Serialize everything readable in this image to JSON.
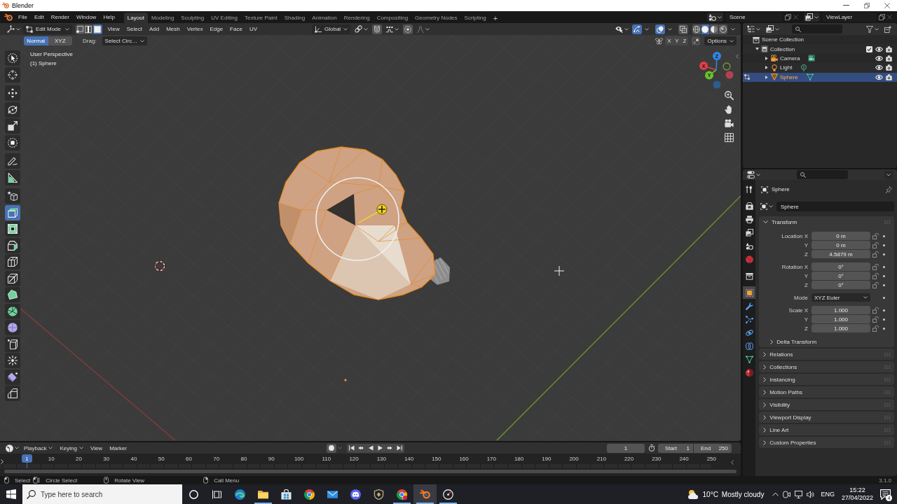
{
  "window": {
    "title": "Blender"
  },
  "menus": [
    "File",
    "Edit",
    "Render",
    "Window",
    "Help"
  ],
  "workspaces": [
    {
      "label": "Layout",
      "selected": true
    },
    {
      "label": "Modeling",
      "selected": false
    },
    {
      "label": "Sculpting",
      "selected": false
    },
    {
      "label": "UV Editing",
      "selected": false
    },
    {
      "label": "Texture Paint",
      "selected": false
    },
    {
      "label": "Shading",
      "selected": false
    },
    {
      "label": "Animation",
      "selected": false
    },
    {
      "label": "Rendering",
      "selected": false
    },
    {
      "label": "Compositing",
      "selected": false
    },
    {
      "label": "Geometry Nodes",
      "selected": false
    },
    {
      "label": "Scripting",
      "selected": false
    }
  ],
  "add_workspace": "+",
  "scene": "Scene",
  "view_layer": "ViewLayer",
  "viewport": {
    "mode": "Edit Mode",
    "select_modes": [
      {
        "kind": "vertex",
        "selected": false
      },
      {
        "kind": "edge",
        "selected": false
      },
      {
        "kind": "face",
        "selected": true
      }
    ],
    "menus": [
      "View",
      "Select",
      "Add",
      "Mesh",
      "Vertex",
      "Edge",
      "Face",
      "UV"
    ],
    "orientation": "Global",
    "snap": false,
    "proportional": false,
    "gizmos": true,
    "overlays": true,
    "xray": false,
    "shading": [
      {
        "kind": "wireframe",
        "selected": false
      },
      {
        "kind": "solid",
        "selected": true
      },
      {
        "kind": "material",
        "selected": false
      },
      {
        "kind": "rendered",
        "selected": false
      }
    ],
    "orient_modes": [
      {
        "label": "Normal",
        "selected": true
      },
      {
        "label": "XYZ",
        "selected": false
      }
    ],
    "drag_label": "Drag:",
    "drag_tool": "Select Circ…",
    "mirror_axes": [
      {
        "label": "X",
        "on": false
      },
      {
        "label": "Y",
        "on": false
      },
      {
        "label": "Z",
        "on": false
      }
    ],
    "auto_merge": false,
    "options": "Options",
    "info": [
      "User Perspective",
      "(1) Sphere"
    ],
    "tools": [
      [
        {
          "kind": "select_circle",
          "selected": false
        },
        {
          "kind": "cursor",
          "selected": false
        }
      ],
      [
        {
          "kind": "move",
          "selected": false
        },
        {
          "kind": "rotate",
          "selected": false
        },
        {
          "kind": "scale",
          "selected": false
        },
        {
          "kind": "transform",
          "selected": false
        }
      ],
      [
        {
          "kind": "annotate",
          "selected": false
        },
        {
          "kind": "measure",
          "selected": false
        }
      ],
      [
        {
          "kind": "add_cube",
          "selected": false
        },
        {
          "kind": "extrude_region",
          "selected": true
        },
        {
          "kind": "inset",
          "selected": false
        },
        {
          "kind": "bevel",
          "selected": false
        },
        {
          "kind": "loop_cut",
          "selected": false
        },
        {
          "kind": "knife",
          "selected": false
        },
        {
          "kind": "poly_build",
          "selected": false
        },
        {
          "kind": "spin",
          "selected": false
        },
        {
          "kind": "smooth",
          "selected": false
        },
        {
          "kind": "edge_slide",
          "selected": false
        },
        {
          "kind": "shrink_fatten",
          "selected": false
        },
        {
          "kind": "shear",
          "selected": false
        },
        {
          "kind": "rip",
          "selected": false
        }
      ]
    ],
    "gizmo_axes": [
      "X",
      "Y",
      "Z"
    ]
  },
  "outliner": {
    "tree": [
      {
        "label": "Scene Collection",
        "kind": "scene_collection",
        "selected": false,
        "children": [
          {
            "label": "Collection",
            "kind": "collection",
            "selected": false,
            "expanded": true,
            "checked": true,
            "visible": true,
            "renderable": true,
            "children": [
              {
                "label": "Camera",
                "kind": "camera",
                "selected": false,
                "expanded": false,
                "visible": true,
                "renderable": true
              },
              {
                "label": "Light",
                "kind": "light",
                "selected": false,
                "expanded": false,
                "visible": true,
                "renderable": true
              },
              {
                "label": "Sphere",
                "kind": "mesh",
                "selected": true,
                "editing": true,
                "expanded": false,
                "visible": true,
                "renderable": true
              }
            ]
          }
        ]
      }
    ]
  },
  "properties": {
    "tabs": [
      [
        {
          "kind": "tool",
          "selected": false
        }
      ],
      [
        {
          "kind": "render",
          "selected": false
        },
        {
          "kind": "output",
          "selected": false
        },
        {
          "kind": "view_layer",
          "selected": false
        },
        {
          "kind": "scene",
          "selected": false
        },
        {
          "kind": "world",
          "selected": false
        }
      ],
      [
        {
          "kind": "collection",
          "selected": false
        }
      ],
      [
        {
          "kind": "object",
          "selected": true
        },
        {
          "kind": "modifiers",
          "selected": false
        },
        {
          "kind": "particles",
          "selected": false
        },
        {
          "kind": "physics",
          "selected": false
        },
        {
          "kind": "constraints",
          "selected": false
        },
        {
          "kind": "data",
          "selected": false
        },
        {
          "kind": "material",
          "selected": false
        }
      ]
    ],
    "context": "Sphere",
    "object_name": "Sphere",
    "transform": {
      "title": "Transform",
      "expanded": true,
      "groups": [
        [
          {
            "kind": "number",
            "label": "Location X",
            "value": "0 m",
            "locked": false
          },
          {
            "kind": "number",
            "label": "Y",
            "value": "0 m",
            "locked": false
          },
          {
            "kind": "number",
            "label": "Z",
            "value": "4.5879 m",
            "locked": false
          }
        ],
        [
          {
            "kind": "number",
            "label": "Rotation X",
            "value": "0°",
            "locked": false
          },
          {
            "kind": "number",
            "label": "Y",
            "value": "0°",
            "locked": false
          },
          {
            "kind": "number",
            "label": "Z",
            "value": "0°",
            "locked": false
          }
        ],
        [
          {
            "kind": "dropdown",
            "label": "Mode",
            "value": "XYZ Euler"
          }
        ],
        [
          {
            "kind": "number",
            "label": "Scale X",
            "value": "1.000",
            "locked": false
          },
          {
            "kind": "number",
            "label": "Y",
            "value": "1.000",
            "locked": false
          },
          {
            "kind": "number",
            "label": "Z",
            "value": "1.000",
            "locked": false
          }
        ]
      ],
      "subpanels": [
        {
          "title": "Delta Transform",
          "expanded": false
        }
      ]
    },
    "panels": [
      {
        "title": "Relations",
        "expanded": false
      },
      {
        "title": "Collections",
        "expanded": false
      },
      {
        "title": "Instancing",
        "expanded": false
      },
      {
        "title": "Motion Paths",
        "expanded": false
      },
      {
        "title": "Visibility",
        "expanded": false
      },
      {
        "title": "Viewport Display",
        "expanded": false
      },
      {
        "title": "Line Art",
        "expanded": false
      },
      {
        "title": "Custom Properties",
        "expanded": false
      }
    ]
  },
  "timeline": {
    "menus": [
      {
        "label": "Playback",
        "kind": "dropdown"
      },
      {
        "label": "Keying",
        "kind": "dropdown"
      },
      {
        "label": "View",
        "kind": "menu"
      },
      {
        "label": "Marker",
        "kind": "menu"
      }
    ],
    "auto_key": false,
    "current_frame": "1",
    "start_label": "Start",
    "start": "1",
    "end_label": "End",
    "end": "250",
    "playhead": "1",
    "ruler": [
      "10",
      "20",
      "30",
      "40",
      "50",
      "60",
      "70",
      "80",
      "90",
      "100",
      "110",
      "120",
      "130",
      "140",
      "150",
      "160",
      "170",
      "180",
      "190",
      "200",
      "210",
      "220",
      "230",
      "240",
      "250"
    ]
  },
  "status_bar": {
    "hints": [
      {
        "kind": "left_click",
        "label": "Select"
      },
      {
        "kind": "left_drag",
        "label": "Circle Select"
      },
      {
        "kind": "middle_drag",
        "label": "Rotate View"
      },
      {
        "kind": "right_click",
        "label": "Call Menu"
      }
    ],
    "version": "3.1.0"
  },
  "taskbar": {
    "search": {
      "placeholder": "Type here to search"
    },
    "apps": [
      {
        "kind": "edge",
        "running": false,
        "active": false
      },
      {
        "kind": "explorer",
        "running": true,
        "active": false
      },
      {
        "kind": "store",
        "running": false,
        "active": false
      },
      {
        "kind": "chrome",
        "running": false,
        "active": false
      },
      {
        "kind": "mail",
        "running": false,
        "active": false
      },
      {
        "kind": "discord",
        "running": false,
        "active": false
      },
      {
        "kind": "league",
        "running": false,
        "active": false
      },
      {
        "kind": "chrome_profile",
        "running": true,
        "active": false
      },
      {
        "kind": "blender",
        "running": true,
        "active": true
      },
      {
        "kind": "gauge",
        "running": true,
        "active": false
      }
    ],
    "temperature": "10°C",
    "weather": "Mostly cloudy",
    "language": "ENG",
    "time": "15:22",
    "date": "27/04/2022",
    "notifications": "4"
  }
}
